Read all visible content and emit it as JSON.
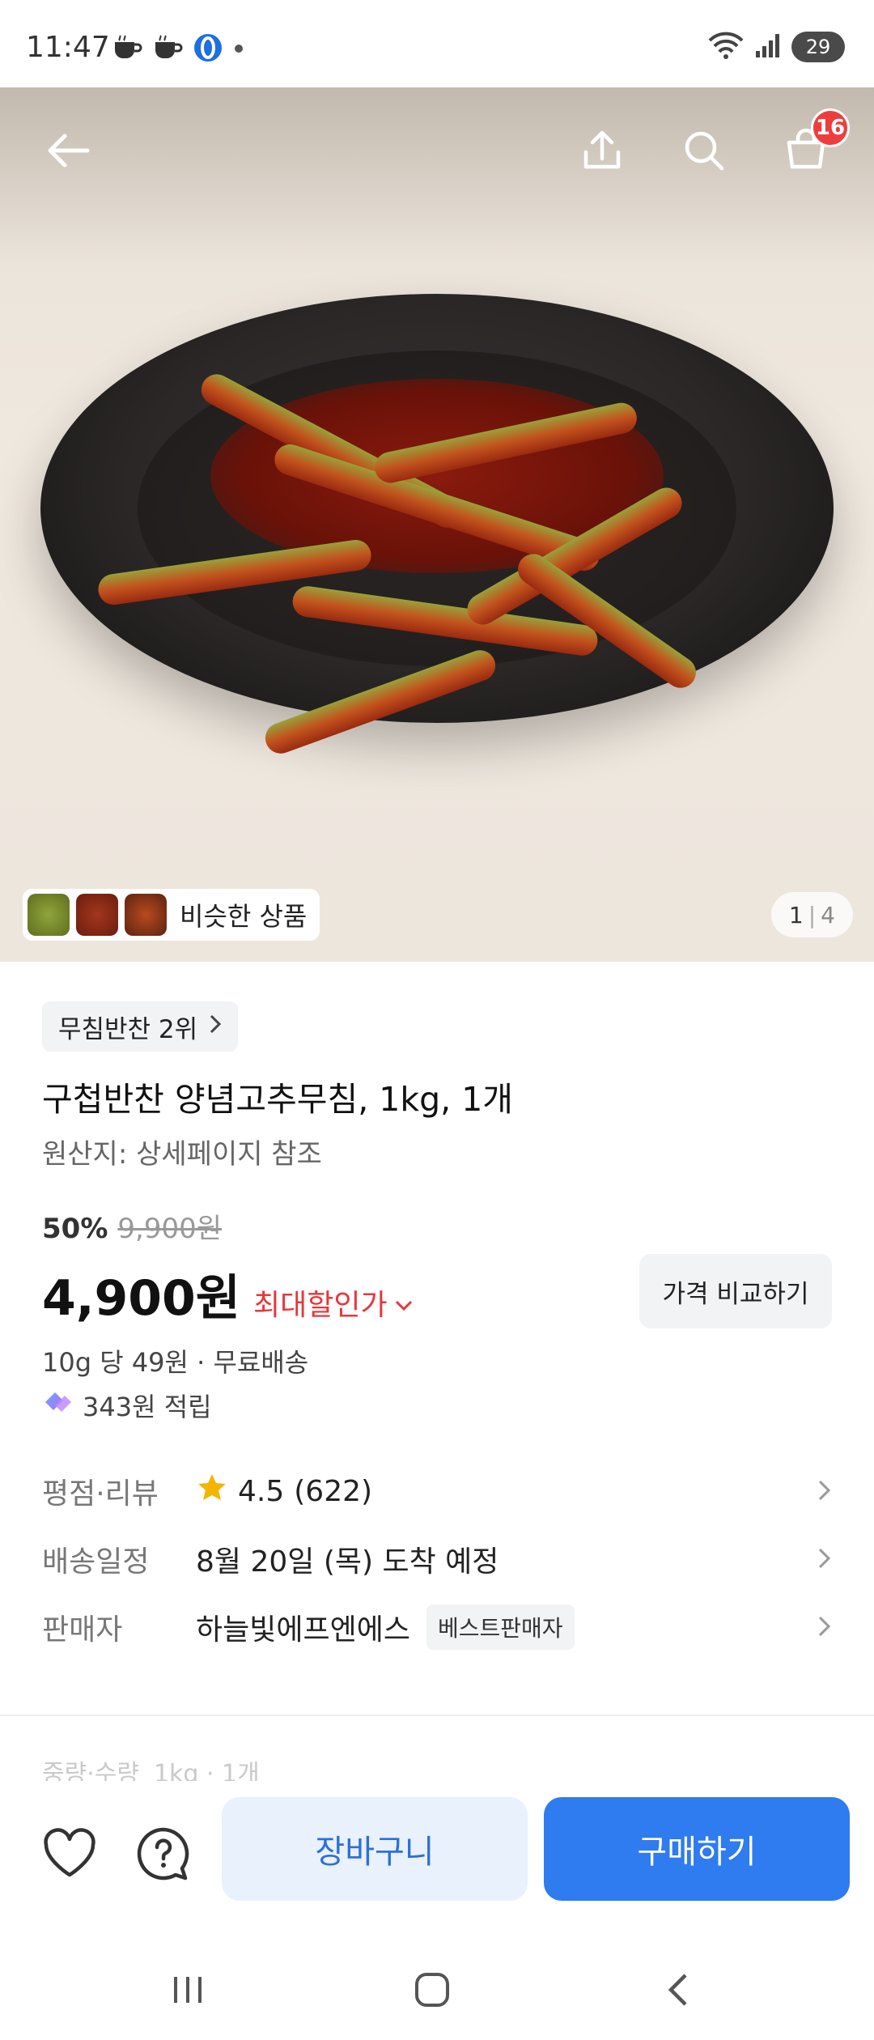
{
  "status_bar": {
    "time": "11:47",
    "battery": "29",
    "icons_left": [
      "coffee-icon",
      "coffee-icon",
      "app-icon",
      "dot-icon"
    ],
    "icons_right": [
      "wifi-icon",
      "signal-icon",
      "battery-icon"
    ]
  },
  "header": {
    "back_icon": "back-arrow-icon",
    "share_icon": "share-icon",
    "search_icon": "search-icon",
    "cart_icon": "cart-icon",
    "cart_count": "16"
  },
  "hero": {
    "similar_label": "비슷한 상품",
    "page_current": "1",
    "page_total": "4"
  },
  "product": {
    "rank": "무침반찬 2위",
    "title": "구첩반찬 양념고추무침, 1kg, 1개",
    "origin": "원산지: 상세페이지 참조",
    "discount_rate": "50%",
    "original_price": "9,900원",
    "price": "4,900원",
    "max_discount": "최대할인가",
    "compare_label": "가격 비교하기",
    "unit_price": "10g 당 49원 · 무료배송",
    "points": "343원 적립"
  },
  "info_rows": {
    "review": {
      "label": "평점·리뷰",
      "rating": "4.5",
      "count": "(622)"
    },
    "delivery": {
      "label": "배송일정",
      "value": "8월 20일 (목) 도착 예정"
    },
    "seller": {
      "label": "판매자",
      "value": "하늘빛에프엔에스",
      "badge": "베스트판매자"
    }
  },
  "option_faded": {
    "label": "중량·수량",
    "value": "1kg · 1개"
  },
  "actions": {
    "cart_label": "장바구니",
    "buy_label": "구매하기"
  },
  "colors": {
    "accent_blue": "#2f7bf0",
    "discount_red": "#e5383b",
    "badge_red": "#ef3d3d"
  }
}
